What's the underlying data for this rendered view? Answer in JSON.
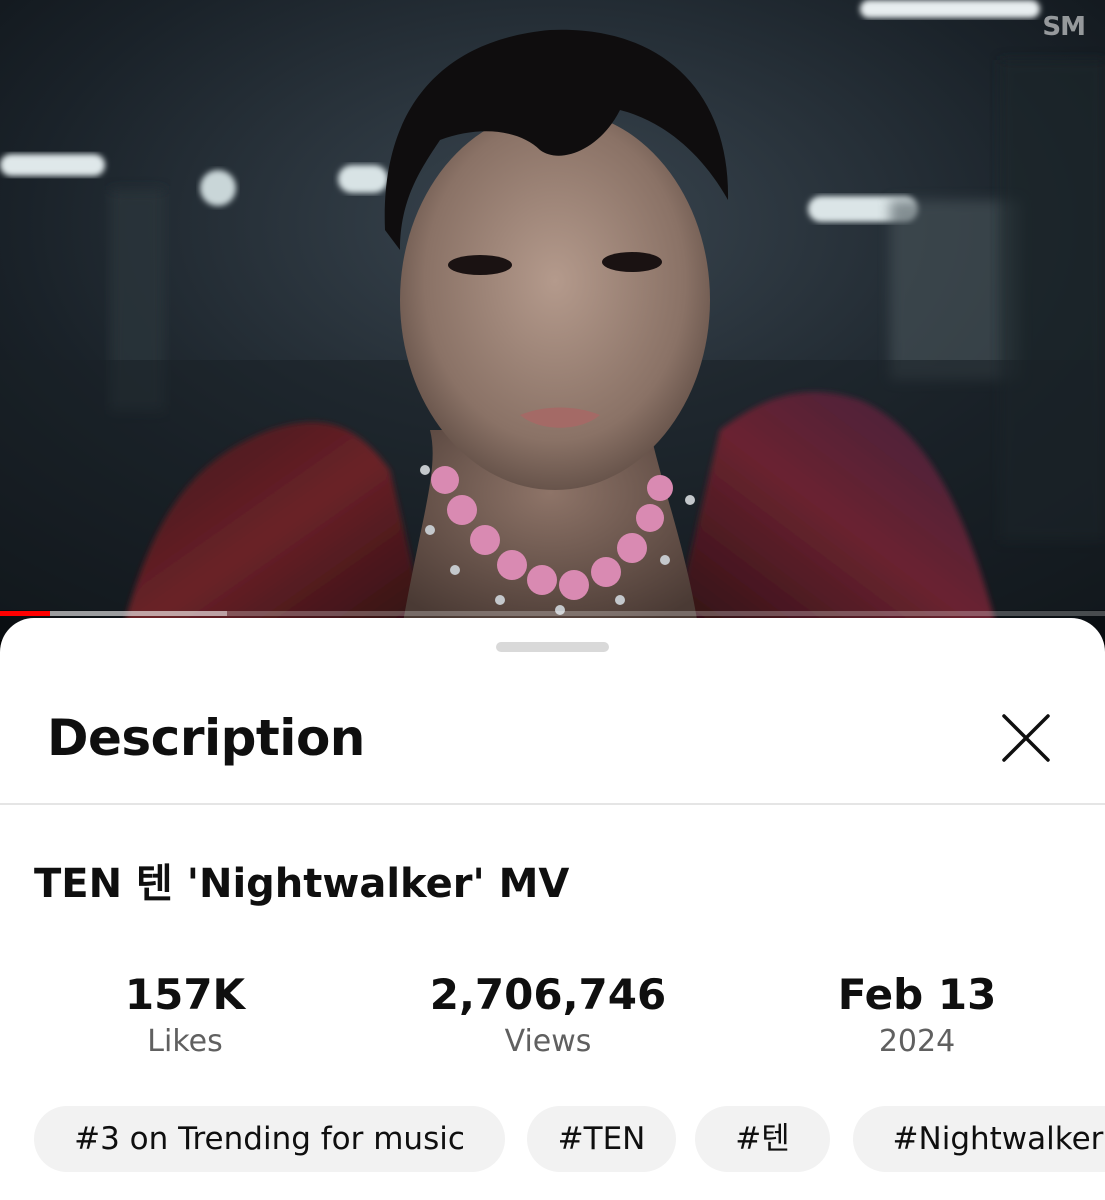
{
  "video": {
    "watermark": "SM",
    "progress": {
      "played_fraction": 0.045,
      "buffered_fraction": 0.205
    }
  },
  "sheet": {
    "title": "Description",
    "close_icon": "close-icon"
  },
  "details": {
    "title": "TEN 텐 'Nightwalker' MV",
    "stats": [
      {
        "value": "157K",
        "label": "Likes"
      },
      {
        "value": "2,706,746",
        "label": "Views"
      },
      {
        "value": "Feb 13",
        "label": "2024"
      }
    ],
    "chips": [
      "#3 on Trending for music",
      "#TEN",
      "#텐",
      "#Nightwalker"
    ]
  },
  "colors": {
    "accent": "#ff0000",
    "sheet_bg": "#ffffff",
    "chip_bg": "#f2f2f2",
    "secondary_text": "#606060"
  }
}
